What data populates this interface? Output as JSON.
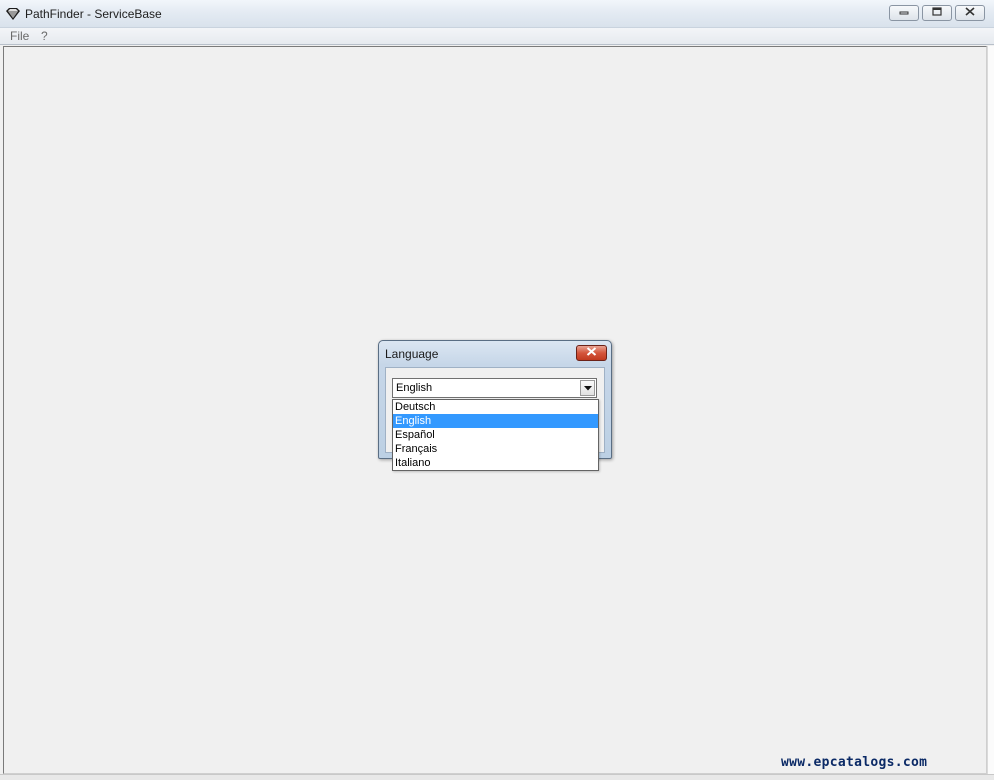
{
  "window": {
    "title": "PathFinder - ServiceBase",
    "icon": "diamond-gem-icon",
    "controls": {
      "minimize": "minimize-icon",
      "maximize": "restore-icon",
      "close": "close-icon"
    }
  },
  "menubar": {
    "items": [
      "File",
      "?"
    ]
  },
  "dialog": {
    "title": "Language",
    "close_icon": "close-icon",
    "combo": {
      "value": "English",
      "options": [
        "Deutsch",
        "English",
        "Español",
        "Français",
        "Italiano"
      ],
      "selected_index": 1
    }
  },
  "watermark": "www.epcatalogs.com",
  "colors": {
    "selection": "#3399ff",
    "dialog_close": "#c94a32",
    "watermark": "#0b2a66"
  }
}
